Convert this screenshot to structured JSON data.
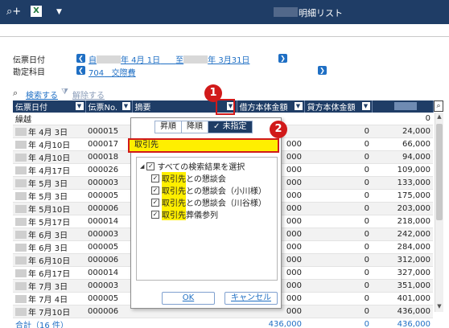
{
  "header": {
    "search_icon": "search-plus-icon",
    "excel_icon": "excel-icon",
    "menu_icon": "dropdown-caret-icon",
    "title": "明細リスト"
  },
  "filters": {
    "date_label": "伝票日付",
    "date_from": "年  4月 1日",
    "date_from_prefix": "自",
    "date_sep": "至",
    "date_to": "年  3月31日",
    "account_label": "勘定科目",
    "account_code": "704",
    "account_name": "交際費"
  },
  "toolbar": {
    "search_label": "検索する",
    "clear_label": "解除する"
  },
  "table": {
    "columns": [
      "伝票日付",
      "伝票No.",
      "摘要",
      "借方本体金額",
      "貸方本体金額",
      ""
    ],
    "carry_label": "繰越",
    "carry_balance": "0",
    "rows": [
      {
        "date": "年  4月  3日",
        "no": "000015",
        "debit": "",
        "credit": "0",
        "balance": "24,000"
      },
      {
        "date": "年  4月10日",
        "no": "000017",
        "debit": "000",
        "credit": "0",
        "balance": "66,000"
      },
      {
        "date": "年  4月10日",
        "no": "000018",
        "debit": "000",
        "credit": "0",
        "balance": "94,000"
      },
      {
        "date": "年  4月17日",
        "no": "000026",
        "debit": "000",
        "credit": "0",
        "balance": "109,000"
      },
      {
        "date": "年  5月  3日",
        "no": "000003",
        "debit": "000",
        "credit": "0",
        "balance": "133,000"
      },
      {
        "date": "年  5月  3日",
        "no": "000005",
        "debit": "000",
        "credit": "0",
        "balance": "175,000"
      },
      {
        "date": "年  5月10日",
        "no": "000006",
        "debit": "000",
        "credit": "0",
        "balance": "203,000"
      },
      {
        "date": "年  5月17日",
        "no": "000014",
        "debit": "000",
        "credit": "0",
        "balance": "218,000"
      },
      {
        "date": "年  6月  3日",
        "no": "000003",
        "debit": "000",
        "credit": "0",
        "balance": "242,000"
      },
      {
        "date": "年  6月  3日",
        "no": "000005",
        "debit": "000",
        "credit": "0",
        "balance": "284,000"
      },
      {
        "date": "年  6月10日",
        "no": "000006",
        "debit": "000",
        "credit": "0",
        "balance": "312,000"
      },
      {
        "date": "年  6月17日",
        "no": "000014",
        "debit": "000",
        "credit": "0",
        "balance": "327,000"
      },
      {
        "date": "年  7月  3日",
        "no": "000003",
        "debit": "000",
        "credit": "0",
        "balance": "351,000"
      },
      {
        "date": "年  7月  4日",
        "no": "000005",
        "debit": "000",
        "credit": "0",
        "balance": "401,000"
      },
      {
        "date": "年  7月10日",
        "no": "000006",
        "debit": "000",
        "credit": "0",
        "balance": "436,000"
      }
    ],
    "total_label": "合計（16 件）",
    "total_debit": "436,000",
    "total_credit": "0",
    "total_balance": "436,000"
  },
  "popup": {
    "sort_asc": "昇順",
    "sort_desc": "降順",
    "sort_none": "未指定",
    "search_value": "取引先",
    "select_all": "すべての検索結果を選択",
    "items": [
      {
        "hl": "取引先",
        "rest": "との懇談会"
      },
      {
        "hl": "取引先",
        "rest": "との懇談会（小川様）"
      },
      {
        "hl": "取引先",
        "rest": "との懇談会（川谷様）"
      },
      {
        "hl": "取引先",
        "rest": "葬儀参列"
      }
    ],
    "ok_label": "OK",
    "cancel_label": "キャンセル"
  },
  "callouts": {
    "one": "1",
    "two": "2"
  },
  "colors": {
    "header_bg": "#1f3d66",
    "link": "#1f6fc4",
    "highlight": "#ffef00",
    "callout": "#d11a1a"
  }
}
